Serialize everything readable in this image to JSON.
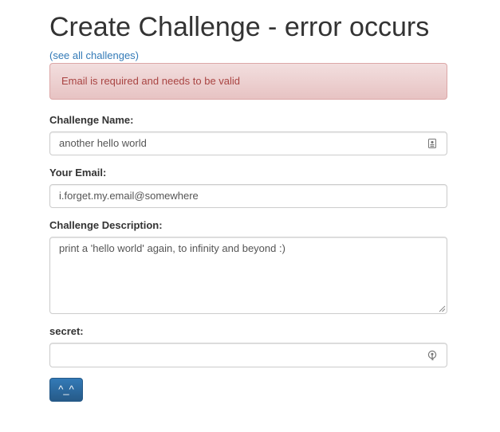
{
  "page": {
    "title": "Create Challenge - error occurs",
    "see_all_link": "(see all challenges)"
  },
  "alert": {
    "message": "Email is required and needs to be valid",
    "color": "#a94442"
  },
  "form": {
    "challenge_name": {
      "label": "Challenge Name:",
      "value": "another hello world",
      "icon": "contact-card-icon"
    },
    "email": {
      "label": "Your Email:",
      "value": "i.forget.my.email@somewhere"
    },
    "description": {
      "label": "Challenge Description:",
      "value": "print a 'hello world' again, to infinity and beyond :)"
    },
    "secret": {
      "label": "secret:",
      "value": "",
      "icon": "password-key-icon"
    },
    "submit_label": "^_^"
  },
  "colors": {
    "link": "#337ab7",
    "button": "#2e6da4",
    "alert_bg": "#f2dede"
  }
}
